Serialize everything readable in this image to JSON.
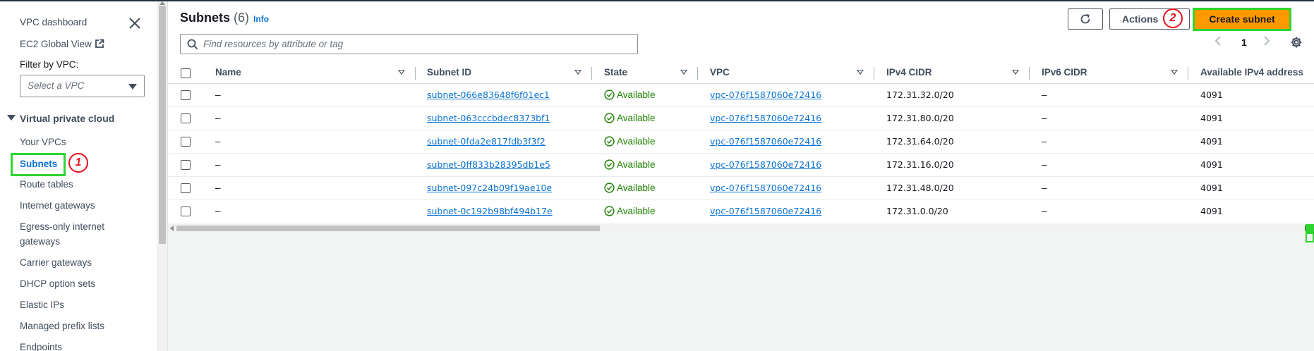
{
  "sidebar": {
    "top_links": [
      "VPC dashboard",
      "EC2 Global View"
    ],
    "filter_label": "Filter by VPC:",
    "vpc_select_placeholder": "Select a VPC",
    "section_title": "Virtual private cloud",
    "items": [
      "Your VPCs",
      "Subnets",
      "Route tables",
      "Internet gateways",
      "Egress-only internet",
      "gateways",
      "Carrier gateways",
      "DHCP option sets",
      "Elastic IPs",
      "Managed prefix lists",
      "Endpoints"
    ],
    "active_item": "Subnets",
    "annotation_1": "1"
  },
  "header": {
    "title": "Subnets",
    "count": "(6)",
    "info": "Info",
    "actions_label": "Actions",
    "annotation_2": "2",
    "create_label": "Create subnet"
  },
  "search": {
    "placeholder": "Find resources by attribute or tag",
    "value": ""
  },
  "pagination": {
    "page": "1"
  },
  "table": {
    "columns": [
      "Name",
      "Subnet ID",
      "State",
      "VPC",
      "IPv4 CIDR",
      "IPv6 CIDR",
      "Available IPv4 address"
    ],
    "rows": [
      {
        "name": "–",
        "subnet_id": "subnet-066e83648f6f01ec1",
        "state": "Available",
        "vpc": "vpc-076f1587060e72416",
        "ipv4": "172.31.32.0/20",
        "ipv6": "–",
        "avail": "4091"
      },
      {
        "name": "–",
        "subnet_id": "subnet-063cccbdec8373bf1",
        "state": "Available",
        "vpc": "vpc-076f1587060e72416",
        "ipv4": "172.31.80.0/20",
        "ipv6": "–",
        "avail": "4091"
      },
      {
        "name": "–",
        "subnet_id": "subnet-0fda2e817fdb3f3f2",
        "state": "Available",
        "vpc": "vpc-076f1587060e72416",
        "ipv4": "172.31.64.0/20",
        "ipv6": "–",
        "avail": "4091"
      },
      {
        "name": "–",
        "subnet_id": "subnet-0ff833b28395db1e5",
        "state": "Available",
        "vpc": "vpc-076f1587060e72416",
        "ipv4": "172.31.16.0/20",
        "ipv6": "–",
        "avail": "4091"
      },
      {
        "name": "–",
        "subnet_id": "subnet-097c24b09f19ae10e",
        "state": "Available",
        "vpc": "vpc-076f1587060e72416",
        "ipv4": "172.31.48.0/20",
        "ipv6": "–",
        "avail": "4091"
      },
      {
        "name": "–",
        "subnet_id": "subnet-0c192b98bf494b17e",
        "state": "Available",
        "vpc": "vpc-076f1587060e72416",
        "ipv4": "172.31.0.0/20",
        "ipv6": "–",
        "avail": "4091"
      }
    ]
  },
  "colors": {
    "accent_link": "#0972d3",
    "create_button": "#ff9900",
    "highlight_box": "#2fd52f",
    "annotation": "#e8101d",
    "state_available": "#1d8102"
  }
}
